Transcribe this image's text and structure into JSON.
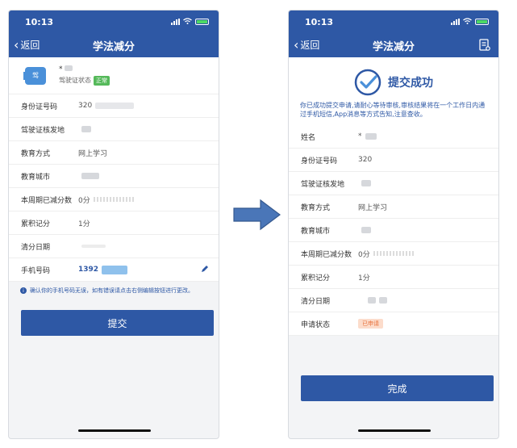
{
  "status": {
    "time": "10:13"
  },
  "nav": {
    "back_label": "返回",
    "title": "学法减分"
  },
  "left": {
    "profile": {
      "name": "*",
      "icon_label": "驾",
      "status_label": "驾驶证状态",
      "status_value": "正常"
    },
    "rows": [
      {
        "label": "身份证号码",
        "value": "320"
      },
      {
        "label": "驾驶证核发地",
        "value": ""
      },
      {
        "label": "教育方式",
        "value": "网上学习"
      },
      {
        "label": "教育城市",
        "value": ""
      },
      {
        "label": "本周期已减分数",
        "value": "0分"
      },
      {
        "label": "累积记分",
        "value": "1分"
      },
      {
        "label": "清分日期",
        "value": ""
      }
    ],
    "phone": {
      "label": "手机号码",
      "value": "1392"
    },
    "notice": "确认你的手机号码无误，如有错误请点击右侧编辑按钮进行更改。",
    "submit_label": "提交"
  },
  "right": {
    "success_title": "提交成功",
    "success_message": "你已成功提交申请,请耐心等待审核,审核结果将在一个工作日内通过手机短信,App消息等方式告知,注意查收。",
    "rows": [
      {
        "label": "姓名",
        "value": "*"
      },
      {
        "label": "身份证号码",
        "value": "320"
      },
      {
        "label": "驾驶证核发地",
        "value": ""
      },
      {
        "label": "教育方式",
        "value": "网上学习"
      },
      {
        "label": "教育城市",
        "value": ""
      },
      {
        "label": "本周期已减分数",
        "value": "0分"
      },
      {
        "label": "累积记分",
        "value": "1分"
      },
      {
        "label": "清分日期",
        "value": ""
      }
    ],
    "apply_status": {
      "label": "申请状态",
      "value": "已申请"
    },
    "done_label": "完成"
  },
  "icons": [
    "signal-icon",
    "wifi-icon",
    "battery-icon",
    "back-chevron-icon",
    "license-icon",
    "edit-icon",
    "info-icon",
    "checkmark-circle-icon",
    "document-icon",
    "arrow-right-icon"
  ],
  "colors": {
    "brand_blue": "#2e58a5",
    "success_green": "#55b95a",
    "applied_orange": "#e8723d",
    "applied_bg": "#fcdccb"
  }
}
